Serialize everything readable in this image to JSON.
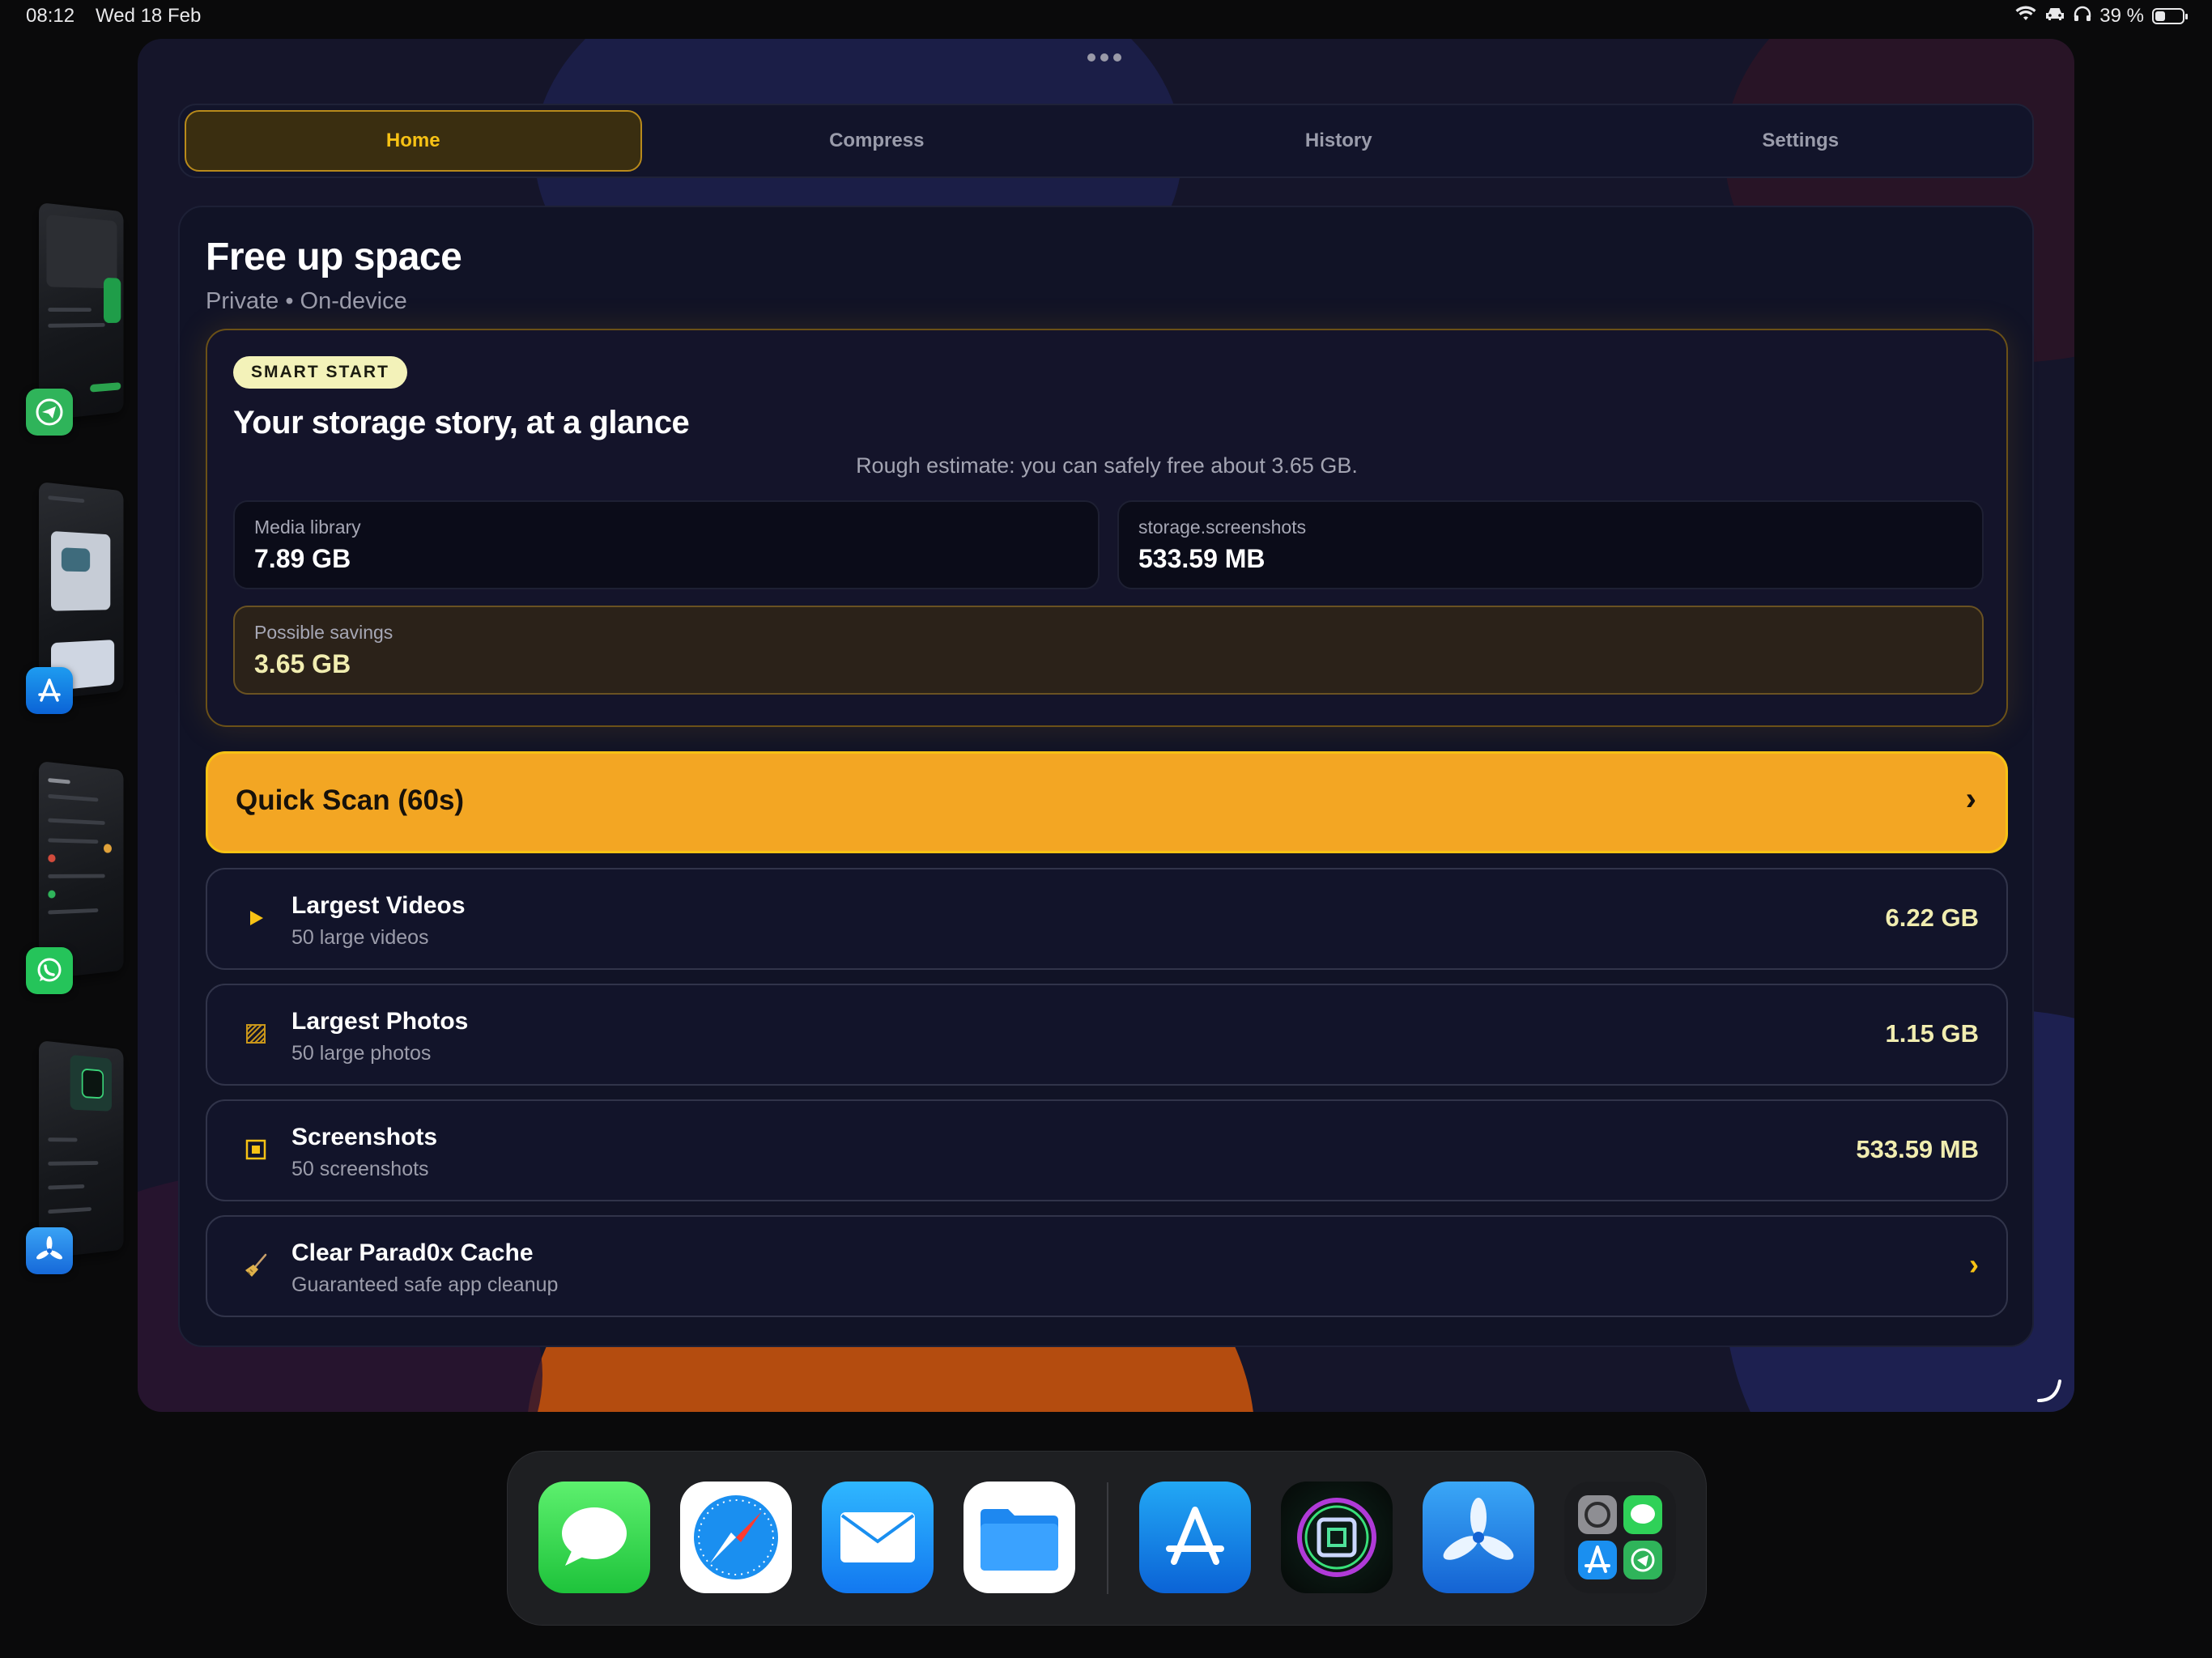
{
  "status_bar": {
    "time": "08:12",
    "date": "Wed 18 Feb",
    "battery": "39 %",
    "battery_level": 0.39
  },
  "tabs": [
    {
      "label": "Home",
      "active": true
    },
    {
      "label": "Compress",
      "active": false
    },
    {
      "label": "History",
      "active": false
    },
    {
      "label": "Settings",
      "active": false
    }
  ],
  "header": {
    "title": "Free up space",
    "subtitle": "Private • On-device"
  },
  "smart_card": {
    "badge": "SMART START",
    "title": "Your storage story, at a glance",
    "estimate": "Rough estimate: you can safely free about 3.65 GB.",
    "stats": [
      {
        "label": "Media library",
        "value": "7.89 GB"
      },
      {
        "label": "storage.screenshots",
        "value": "533.59 MB"
      }
    ],
    "savings": {
      "label": "Possible savings",
      "value": "3.65 GB"
    }
  },
  "quick_scan": {
    "label": "Quick Scan (60s)",
    "chevron": "›"
  },
  "rows": [
    {
      "icon": "play-icon",
      "title": "Largest Videos",
      "subtitle": "50 large videos",
      "value": "6.22 GB"
    },
    {
      "icon": "photo-grid-icon",
      "title": "Largest Photos",
      "subtitle": "50 large photos",
      "value": "1.15 GB"
    },
    {
      "icon": "screenshot-icon",
      "title": "Screenshots",
      "subtitle": "50 screenshots",
      "value": "533.59 MB"
    },
    {
      "icon": "broom-icon",
      "title": "Clear Parad0x Cache",
      "subtitle": "Guaranteed safe app cleanup",
      "chevron": "›"
    }
  ],
  "stage_apps": [
    "telegram-icon",
    "app-store-icon",
    "whatsapp-icon",
    "testflight-icon"
  ],
  "dock": {
    "apps": [
      "messages-icon",
      "safari-icon",
      "mail-icon",
      "files-icon",
      "app-store-icon",
      "parad0x-icon",
      "testflight-icon",
      "app-folder-icon"
    ]
  },
  "colors": {
    "accent": "#f3a623",
    "accent_text": "#f7c215",
    "value_text": "#f1edb0",
    "panel": "#111326"
  }
}
